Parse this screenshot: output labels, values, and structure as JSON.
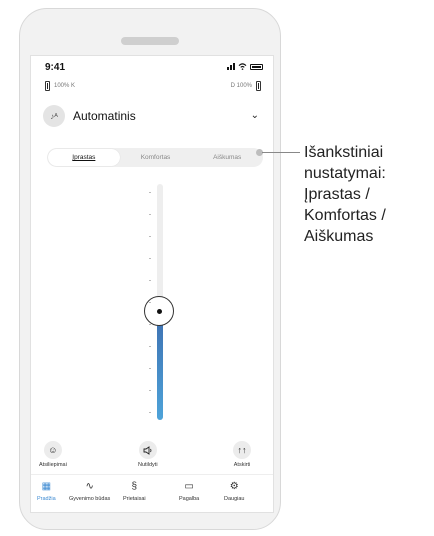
{
  "status": {
    "time": "9:41"
  },
  "hearing_aids": {
    "left_label": "100% K",
    "right_label": "D 100%"
  },
  "program": {
    "name": "Automatinis",
    "icon": "auto-program-icon"
  },
  "segments": [
    "Įprastas",
    "Komfortas",
    "Aiškumas"
  ],
  "slider": {
    "level_fraction": 0.46
  },
  "actions": [
    {
      "label": "Atsiliepimai",
      "icon": "smiley-icon"
    },
    {
      "label": "Nutildyti",
      "icon": "speaker-icon"
    },
    {
      "label": "Atskirti",
      "icon": "split-icon"
    }
  ],
  "nav": [
    {
      "label": "Pradžia",
      "icon": "grid-icon",
      "active": true
    },
    {
      "label": "Gyvenimo būdas",
      "icon": "activity-icon",
      "active": false
    },
    {
      "label": "Prietaisai",
      "icon": "hearing-aid-icon",
      "active": false
    },
    {
      "label": "Pagalba",
      "icon": "chat-icon",
      "active": false
    },
    {
      "label": "Daugiau",
      "icon": "gear-icon",
      "active": false
    }
  ],
  "callout": {
    "lines": [
      "Išankstiniai",
      "nustatymai:",
      "Įprastas /",
      "Komfortas /",
      "Aiškumas"
    ]
  },
  "colors": {
    "accent": "#3c8ad2",
    "slider_fill": "#4ea3d9"
  }
}
